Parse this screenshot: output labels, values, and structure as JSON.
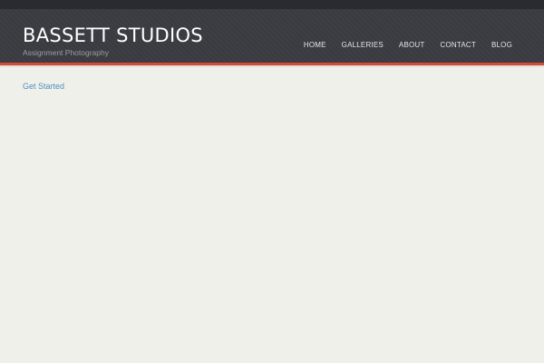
{
  "header": {
    "brand": "BASSETT STUDIOS",
    "tagline": "Assignment Photography"
  },
  "nav": {
    "items": [
      {
        "label": "HOME"
      },
      {
        "label": "GALLERIES"
      },
      {
        "label": "ABOUT"
      },
      {
        "label": "CONTACT"
      },
      {
        "label": "BLOG"
      }
    ]
  },
  "main": {
    "link": "Get Started"
  },
  "colors": {
    "accent": "#d64a3a",
    "header_bg": "#3a3c42",
    "page_bg": "#f0f0eb",
    "link": "#4a90c0"
  }
}
